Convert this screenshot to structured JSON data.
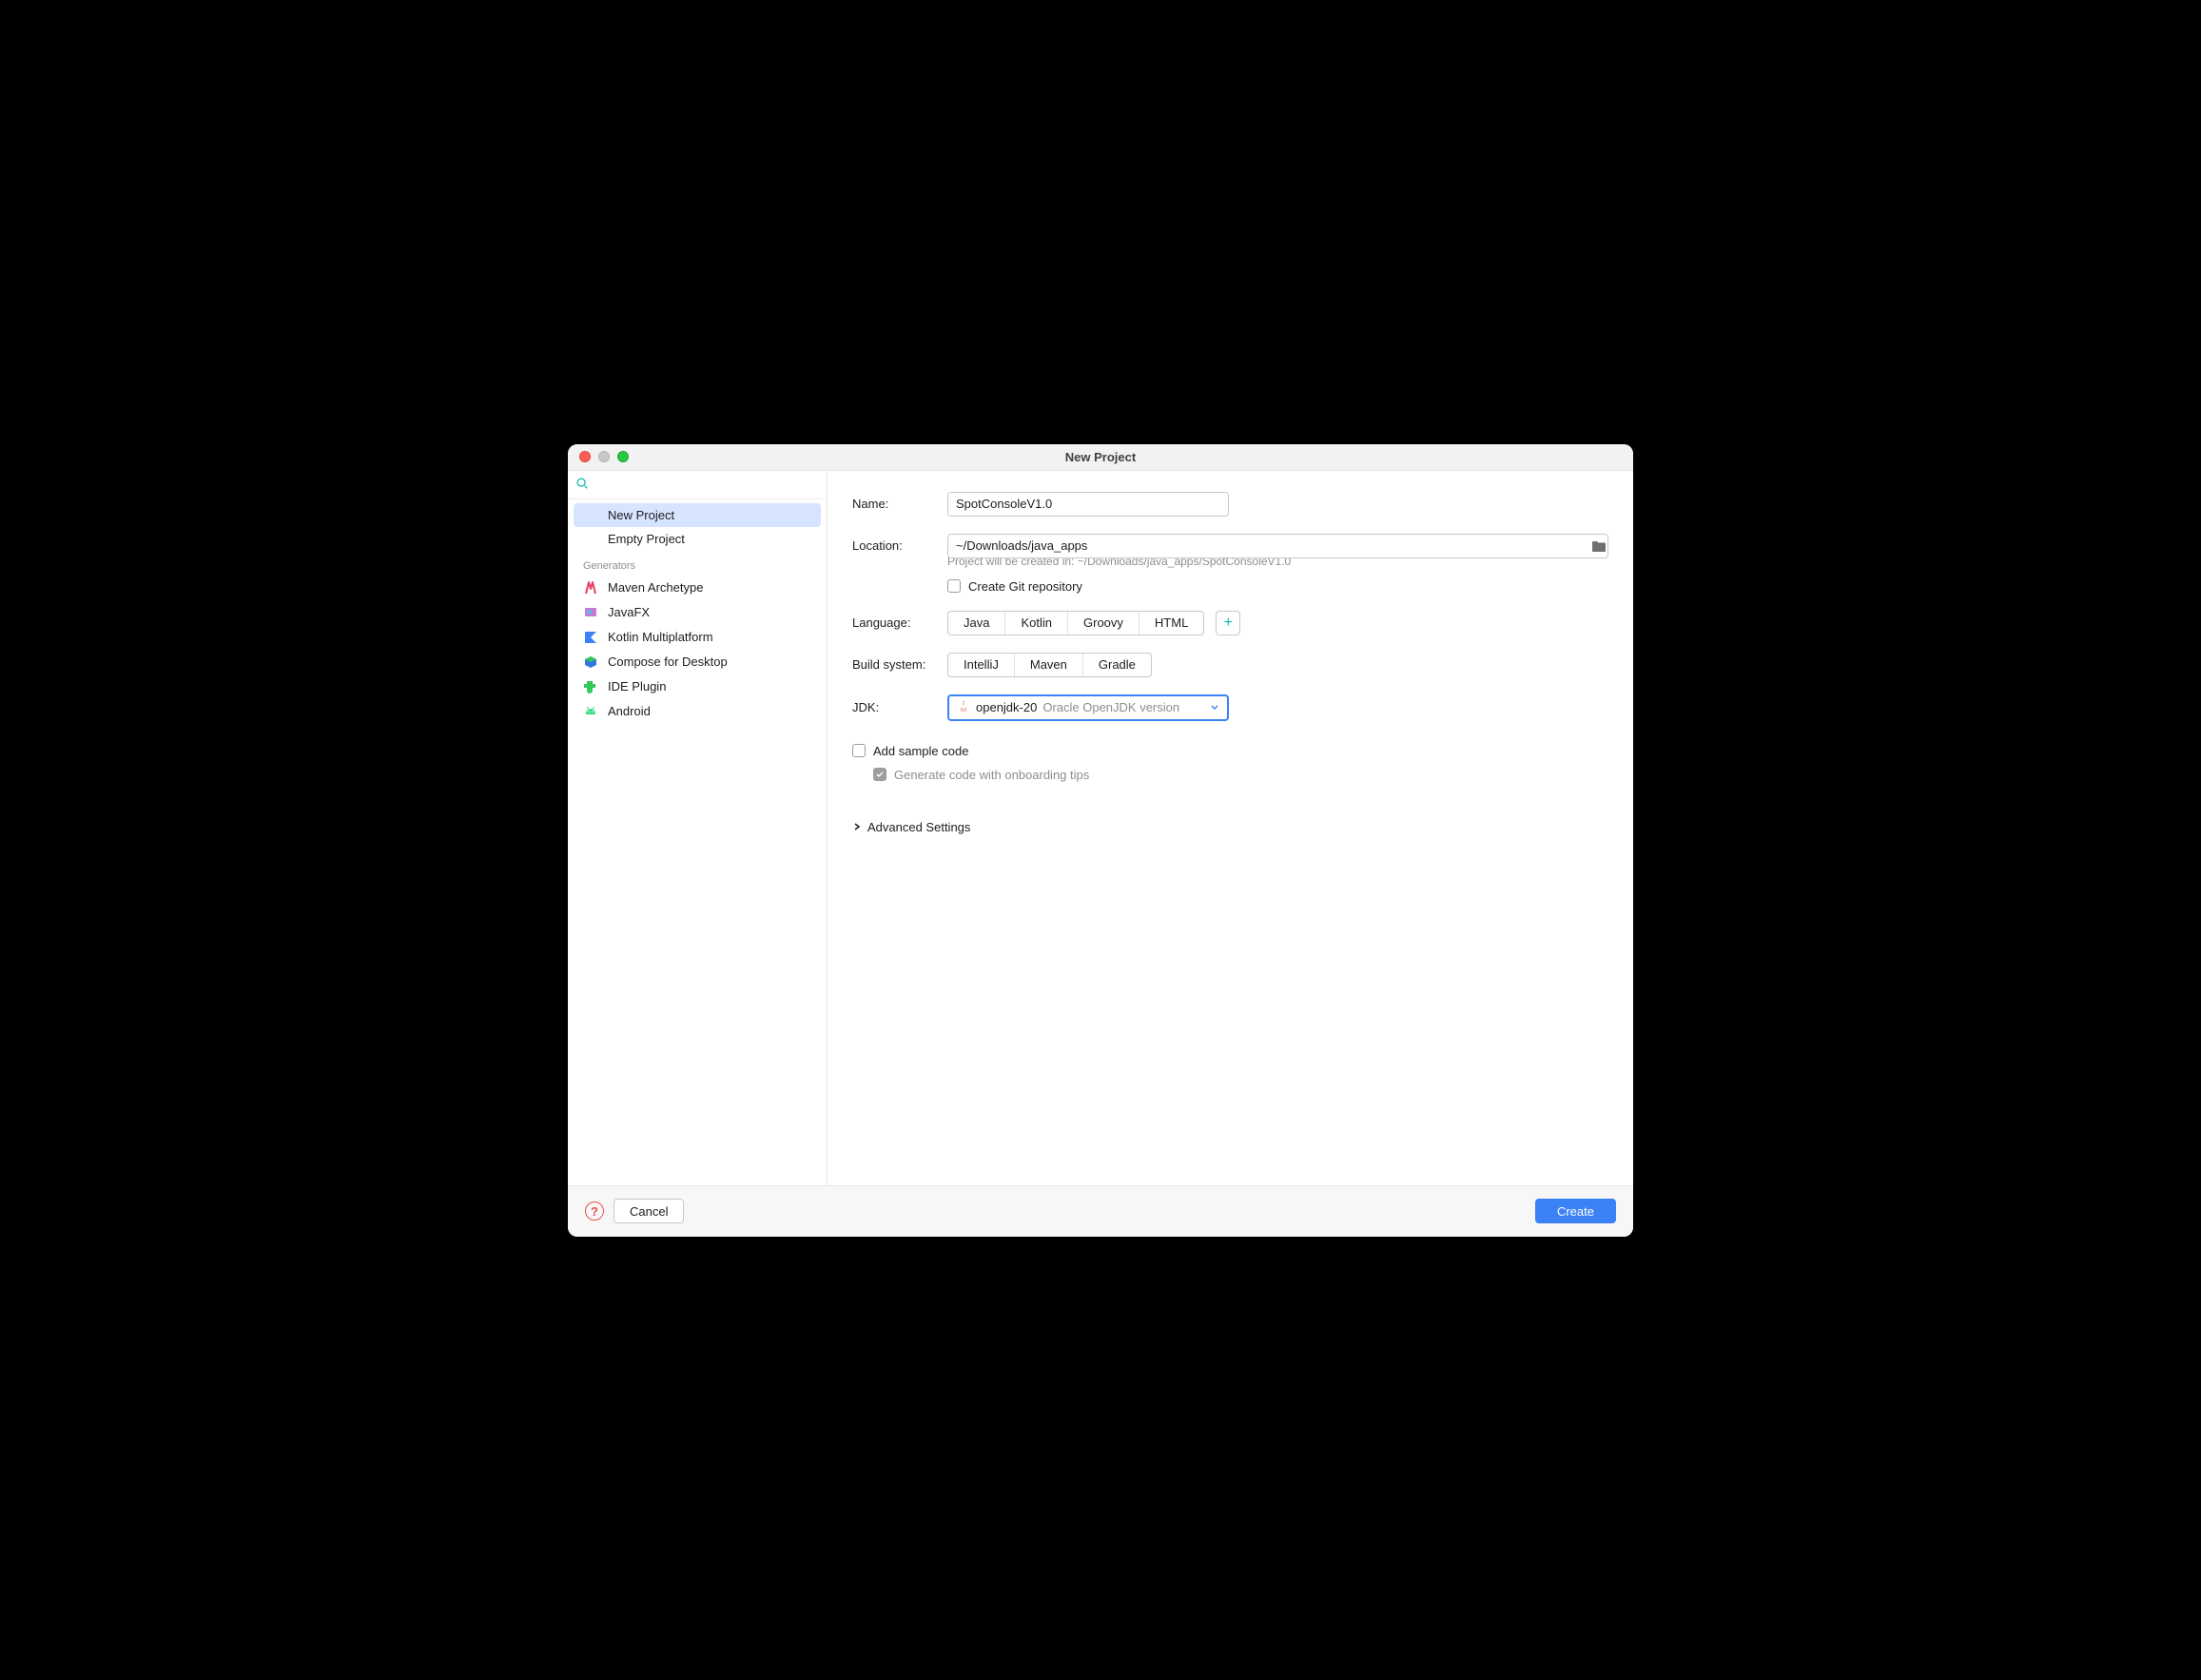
{
  "window": {
    "title": "New Project"
  },
  "sidebar": {
    "search_placeholder": "",
    "items": [
      {
        "label": "New Project",
        "icon": "none",
        "selected": true
      },
      {
        "label": "Empty Project",
        "icon": "none"
      }
    ],
    "generators_header": "Generators",
    "generators": [
      {
        "label": "Maven Archetype",
        "icon": "maven"
      },
      {
        "label": "JavaFX",
        "icon": "javafx"
      },
      {
        "label": "Kotlin Multiplatform",
        "icon": "kotlin"
      },
      {
        "label": "Compose for Desktop",
        "icon": "compose"
      },
      {
        "label": "IDE Plugin",
        "icon": "plugin"
      },
      {
        "label": "Android",
        "icon": "android"
      }
    ]
  },
  "form": {
    "name_label": "Name:",
    "name_value": "SpotConsoleV1.0",
    "location_label": "Location:",
    "location_value": "~/Downloads/java_apps",
    "location_hint": "Project will be created in: ~/Downloads/java_apps/SpotConsoleV1.0",
    "git_label": "Create Git repository",
    "language_label": "Language:",
    "languages": [
      "Java",
      "Kotlin",
      "Groovy",
      "HTML"
    ],
    "build_label": "Build system:",
    "builds": [
      "IntelliJ",
      "Maven",
      "Gradle"
    ],
    "jdk_label": "JDK:",
    "jdk_value": "openjdk-20",
    "jdk_detail": "Oracle OpenJDK version",
    "sample_label": "Add sample code",
    "onboarding_label": "Generate code with onboarding tips",
    "advanced_label": "Advanced Settings"
  },
  "footer": {
    "cancel_label": "Cancel",
    "create_label": "Create"
  }
}
